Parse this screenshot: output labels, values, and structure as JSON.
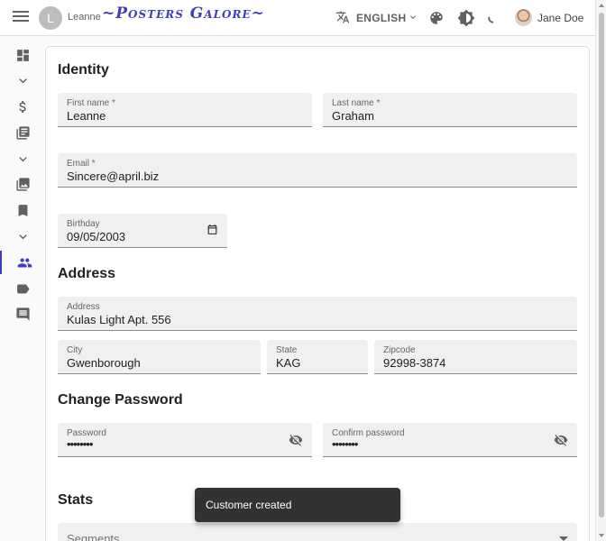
{
  "appbar": {
    "user_initial": "L",
    "user_name": "Leanne",
    "brand": "~Posters Galore~",
    "language": "ENGLISH",
    "account_name": "Jane Doe"
  },
  "colors": {
    "accent": "#3f3cbf",
    "field_bg": "#f0f0f0",
    "snackbar_bg": "#323232"
  },
  "sidebar": {
    "items": [
      {
        "icon": "dashboard-icon"
      },
      {
        "icon": "chevron-down-icon"
      },
      {
        "icon": "dollar-icon"
      },
      {
        "icon": "library-books-icon"
      },
      {
        "icon": "chevron-down-icon"
      },
      {
        "icon": "collections-icon"
      },
      {
        "icon": "bookmark-icon"
      },
      {
        "icon": "chevron-down-icon"
      },
      {
        "icon": "people-icon",
        "active": true
      },
      {
        "icon": "label-icon"
      },
      {
        "icon": "comment-icon"
      }
    ]
  },
  "form": {
    "identity": {
      "title": "Identity",
      "first_name": {
        "label": "First name *",
        "value": "Leanne"
      },
      "last_name": {
        "label": "Last name *",
        "value": "Graham"
      },
      "email": {
        "label": "Email *",
        "value": "Sincere@april.biz"
      },
      "birthday": {
        "label": "Birthday",
        "value": "09/05/2003"
      }
    },
    "address": {
      "title": "Address",
      "address": {
        "label": "Address",
        "value": "Kulas Light Apt. 556"
      },
      "city": {
        "label": "City",
        "value": "Gwenborough"
      },
      "state": {
        "label": "State",
        "value": "KAG"
      },
      "zipcode": {
        "label": "Zipcode",
        "value": "92998-3874"
      }
    },
    "password": {
      "title": "Change Password",
      "password": {
        "label": "Password",
        "value": "••••••••"
      },
      "confirm": {
        "label": "Confirm password",
        "value": "••••••••"
      }
    },
    "stats": {
      "title": "Stats",
      "segments_placeholder": "Segments"
    }
  },
  "snackbar": {
    "message": "Customer created"
  }
}
